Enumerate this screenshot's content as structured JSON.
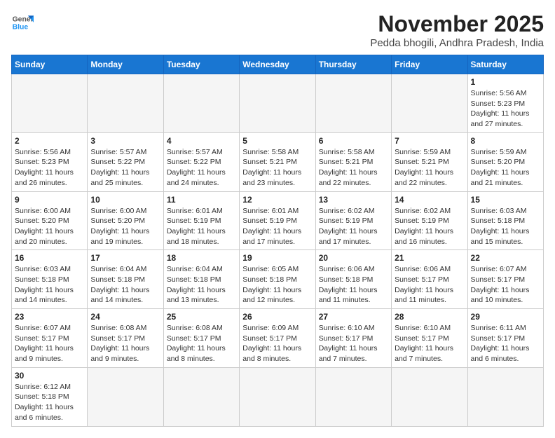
{
  "header": {
    "logo_line1": "General",
    "logo_line2": "Blue",
    "month_title": "November 2025",
    "location": "Pedda bhogili, Andhra Pradesh, India"
  },
  "days_of_week": [
    "Sunday",
    "Monday",
    "Tuesday",
    "Wednesday",
    "Thursday",
    "Friday",
    "Saturday"
  ],
  "weeks": [
    [
      {
        "day": null,
        "info": ""
      },
      {
        "day": null,
        "info": ""
      },
      {
        "day": null,
        "info": ""
      },
      {
        "day": null,
        "info": ""
      },
      {
        "day": null,
        "info": ""
      },
      {
        "day": null,
        "info": ""
      },
      {
        "day": "1",
        "info": "Sunrise: 5:56 AM\nSunset: 5:23 PM\nDaylight: 11 hours\nand 27 minutes."
      }
    ],
    [
      {
        "day": "2",
        "info": "Sunrise: 5:56 AM\nSunset: 5:23 PM\nDaylight: 11 hours\nand 26 minutes."
      },
      {
        "day": "3",
        "info": "Sunrise: 5:57 AM\nSunset: 5:22 PM\nDaylight: 11 hours\nand 25 minutes."
      },
      {
        "day": "4",
        "info": "Sunrise: 5:57 AM\nSunset: 5:22 PM\nDaylight: 11 hours\nand 24 minutes."
      },
      {
        "day": "5",
        "info": "Sunrise: 5:58 AM\nSunset: 5:21 PM\nDaylight: 11 hours\nand 23 minutes."
      },
      {
        "day": "6",
        "info": "Sunrise: 5:58 AM\nSunset: 5:21 PM\nDaylight: 11 hours\nand 22 minutes."
      },
      {
        "day": "7",
        "info": "Sunrise: 5:59 AM\nSunset: 5:21 PM\nDaylight: 11 hours\nand 22 minutes."
      },
      {
        "day": "8",
        "info": "Sunrise: 5:59 AM\nSunset: 5:20 PM\nDaylight: 11 hours\nand 21 minutes."
      }
    ],
    [
      {
        "day": "9",
        "info": "Sunrise: 6:00 AM\nSunset: 5:20 PM\nDaylight: 11 hours\nand 20 minutes."
      },
      {
        "day": "10",
        "info": "Sunrise: 6:00 AM\nSunset: 5:20 PM\nDaylight: 11 hours\nand 19 minutes."
      },
      {
        "day": "11",
        "info": "Sunrise: 6:01 AM\nSunset: 5:19 PM\nDaylight: 11 hours\nand 18 minutes."
      },
      {
        "day": "12",
        "info": "Sunrise: 6:01 AM\nSunset: 5:19 PM\nDaylight: 11 hours\nand 17 minutes."
      },
      {
        "day": "13",
        "info": "Sunrise: 6:02 AM\nSunset: 5:19 PM\nDaylight: 11 hours\nand 17 minutes."
      },
      {
        "day": "14",
        "info": "Sunrise: 6:02 AM\nSunset: 5:19 PM\nDaylight: 11 hours\nand 16 minutes."
      },
      {
        "day": "15",
        "info": "Sunrise: 6:03 AM\nSunset: 5:18 PM\nDaylight: 11 hours\nand 15 minutes."
      }
    ],
    [
      {
        "day": "16",
        "info": "Sunrise: 6:03 AM\nSunset: 5:18 PM\nDaylight: 11 hours\nand 14 minutes."
      },
      {
        "day": "17",
        "info": "Sunrise: 6:04 AM\nSunset: 5:18 PM\nDaylight: 11 hours\nand 14 minutes."
      },
      {
        "day": "18",
        "info": "Sunrise: 6:04 AM\nSunset: 5:18 PM\nDaylight: 11 hours\nand 13 minutes."
      },
      {
        "day": "19",
        "info": "Sunrise: 6:05 AM\nSunset: 5:18 PM\nDaylight: 11 hours\nand 12 minutes."
      },
      {
        "day": "20",
        "info": "Sunrise: 6:06 AM\nSunset: 5:18 PM\nDaylight: 11 hours\nand 11 minutes."
      },
      {
        "day": "21",
        "info": "Sunrise: 6:06 AM\nSunset: 5:17 PM\nDaylight: 11 hours\nand 11 minutes."
      },
      {
        "day": "22",
        "info": "Sunrise: 6:07 AM\nSunset: 5:17 PM\nDaylight: 11 hours\nand 10 minutes."
      }
    ],
    [
      {
        "day": "23",
        "info": "Sunrise: 6:07 AM\nSunset: 5:17 PM\nDaylight: 11 hours\nand 9 minutes."
      },
      {
        "day": "24",
        "info": "Sunrise: 6:08 AM\nSunset: 5:17 PM\nDaylight: 11 hours\nand 9 minutes."
      },
      {
        "day": "25",
        "info": "Sunrise: 6:08 AM\nSunset: 5:17 PM\nDaylight: 11 hours\nand 8 minutes."
      },
      {
        "day": "26",
        "info": "Sunrise: 6:09 AM\nSunset: 5:17 PM\nDaylight: 11 hours\nand 8 minutes."
      },
      {
        "day": "27",
        "info": "Sunrise: 6:10 AM\nSunset: 5:17 PM\nDaylight: 11 hours\nand 7 minutes."
      },
      {
        "day": "28",
        "info": "Sunrise: 6:10 AM\nSunset: 5:17 PM\nDaylight: 11 hours\nand 7 minutes."
      },
      {
        "day": "29",
        "info": "Sunrise: 6:11 AM\nSunset: 5:17 PM\nDaylight: 11 hours\nand 6 minutes."
      }
    ],
    [
      {
        "day": "30",
        "info": "Sunrise: 6:12 AM\nSunset: 5:18 PM\nDaylight: 11 hours\nand 6 minutes."
      },
      {
        "day": null,
        "info": ""
      },
      {
        "day": null,
        "info": ""
      },
      {
        "day": null,
        "info": ""
      },
      {
        "day": null,
        "info": ""
      },
      {
        "day": null,
        "info": ""
      },
      {
        "day": null,
        "info": ""
      }
    ]
  ]
}
